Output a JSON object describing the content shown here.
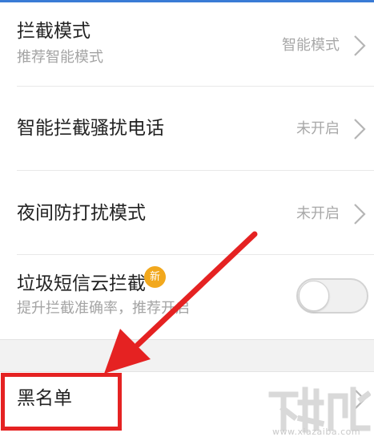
{
  "settings": {
    "rows": [
      {
        "title": "拦截模式",
        "subtitle": "推荐智能模式",
        "value": "智能模式"
      },
      {
        "title": "智能拦截骚扰电话",
        "value": "未开启"
      },
      {
        "title": "夜间防打扰模式",
        "value": "未开启"
      },
      {
        "title": "垃圾短信云拦截",
        "subtitle": "提升拦截准确率，推荐开启",
        "badge": "新",
        "toggle_state": "off"
      },
      {
        "title": "黑名单"
      }
    ]
  },
  "annotation": {
    "arrow_color": "#e52222",
    "box_color": "#e52222"
  },
  "watermark": {
    "text": "www.xiazaiba.com"
  }
}
